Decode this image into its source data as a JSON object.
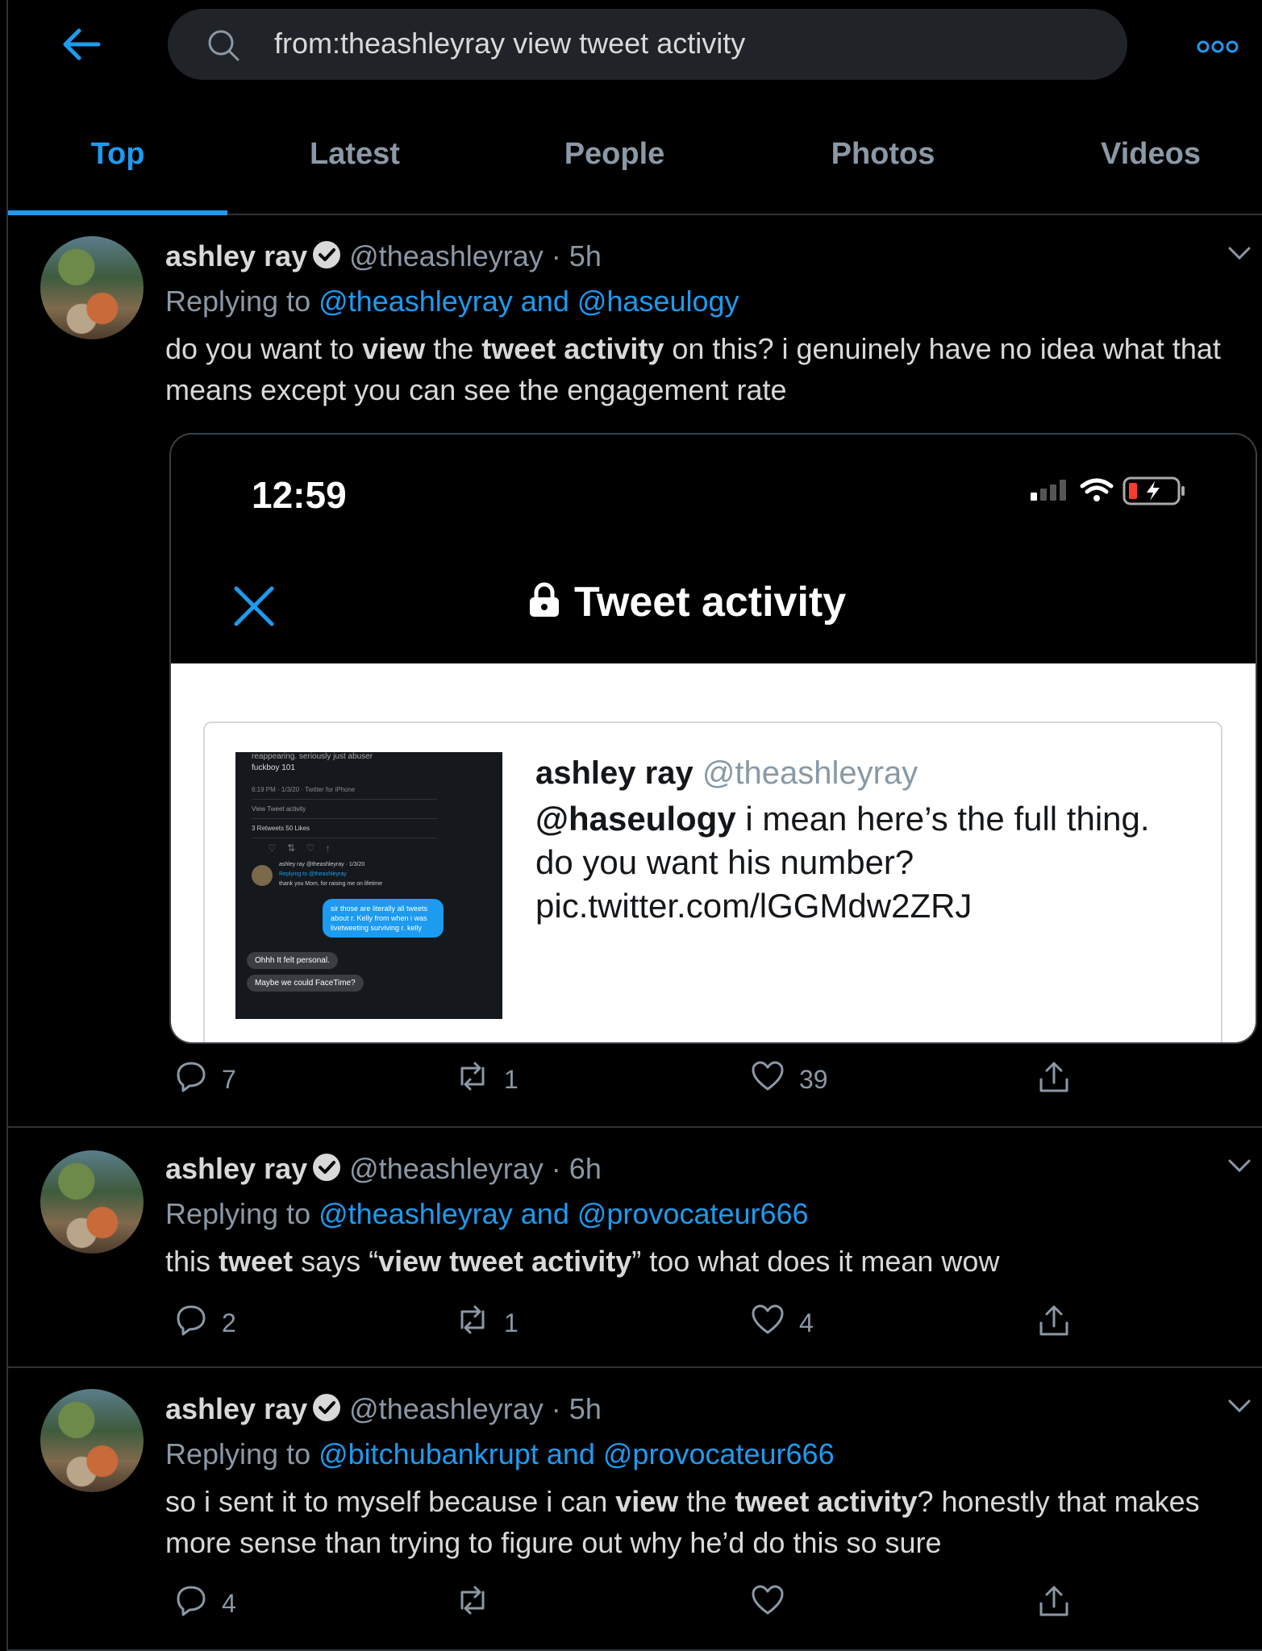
{
  "search": {
    "query": "from:theashleyray view tweet activity"
  },
  "tabs": [
    "Top",
    "Latest",
    "People",
    "Photos",
    "Videos"
  ],
  "colors": {
    "accent": "#1d9bf0",
    "background": "#000000",
    "muted": "#8b98a5"
  },
  "tweets": [
    {
      "name": "ashley ray",
      "handle": "@theashleyray · 5h",
      "replying_prefix": "Replying to ",
      "replying_links": "@theashleyray and @haseulogy",
      "text": [
        {
          "t": "do you want to "
        },
        {
          "b": "view"
        },
        {
          "t": " the "
        },
        {
          "b": "tweet activity"
        },
        {
          "t": " on this? i genuinely have no idea what that means except you can see the engagement rate"
        }
      ],
      "replies": "7",
      "retweets": "1",
      "likes": "39"
    },
    {
      "name": "ashley ray",
      "handle": "@theashleyray · 6h",
      "replying_prefix": "Replying to ",
      "replying_links": "@theashleyray and @provocateur666",
      "text": [
        {
          "t": "this "
        },
        {
          "b": "tweet"
        },
        {
          "t": " says “"
        },
        {
          "b": "view tweet activity"
        },
        {
          "t": "” too what does it mean wow"
        }
      ],
      "replies": "2",
      "retweets": "1",
      "likes": "4"
    },
    {
      "name": "ashley ray",
      "handle": "@theashleyray · 5h",
      "replying_prefix": "Replying to ",
      "replying_links": "@bitchubankrupt and @provocateur666",
      "text": [
        {
          "t": "so i sent it to myself because i can "
        },
        {
          "b": "view"
        },
        {
          "t": " the "
        },
        {
          "b": "tweet activity"
        },
        {
          "t": "? honestly that makes more sense than trying to figure out why he’d do this so sure"
        }
      ],
      "replies": "4",
      "retweets": "",
      "likes": ""
    }
  ],
  "embed": {
    "time": "12:59",
    "title": "Tweet activity",
    "card_name": "ashley ray",
    "card_handle": "@theashleyray",
    "card_mention": "@haseulogy",
    "card_text": " i mean here’s the full thing. do you want his number? pic.twitter.com/lGGMdw2ZRJ",
    "thumb": {
      "line1": "reappearing. seriously just abuser",
      "line2": "fuckboy 101",
      "line3": "6:19 PM · 1/3/20 · Twitter for iPhone",
      "line4": "View Tweet activity",
      "line5": "3 Retweets  50 Likes",
      "line6": "ashley ray @theashleyray · 1/3/20",
      "line7": "Replying to @theashleyray",
      "line8": "thank you Mom, for raising me on lifetime",
      "blue_bubble": "sir those are literally all tweets about r. Kelly from when i was livetweeting surviving r. kelly",
      "gray1": "Ohhh It felt personal.",
      "gray2": "Maybe we could FaceTime?"
    }
  }
}
